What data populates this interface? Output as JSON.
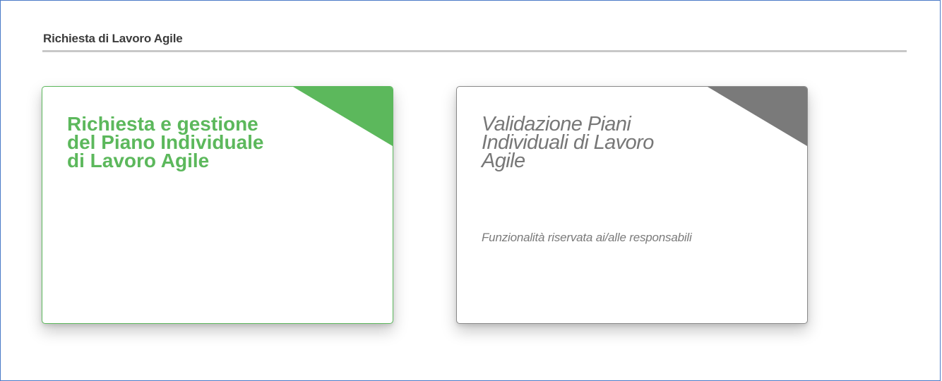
{
  "section": {
    "title": "Richiesta di Lavoro Agile"
  },
  "cards": [
    {
      "title": "Richiesta e gestione\ndel Piano Individuale\ndi Lavoro Agile",
      "accent_color": "#5cb85c",
      "enabled": true
    },
    {
      "title": "Validazione Piani\nIndividuali di Lavoro\nAgile",
      "subtitle": "Funzionalità riservata ai/alle responsabili",
      "accent_color": "#7a7a7a",
      "enabled": false
    }
  ]
}
